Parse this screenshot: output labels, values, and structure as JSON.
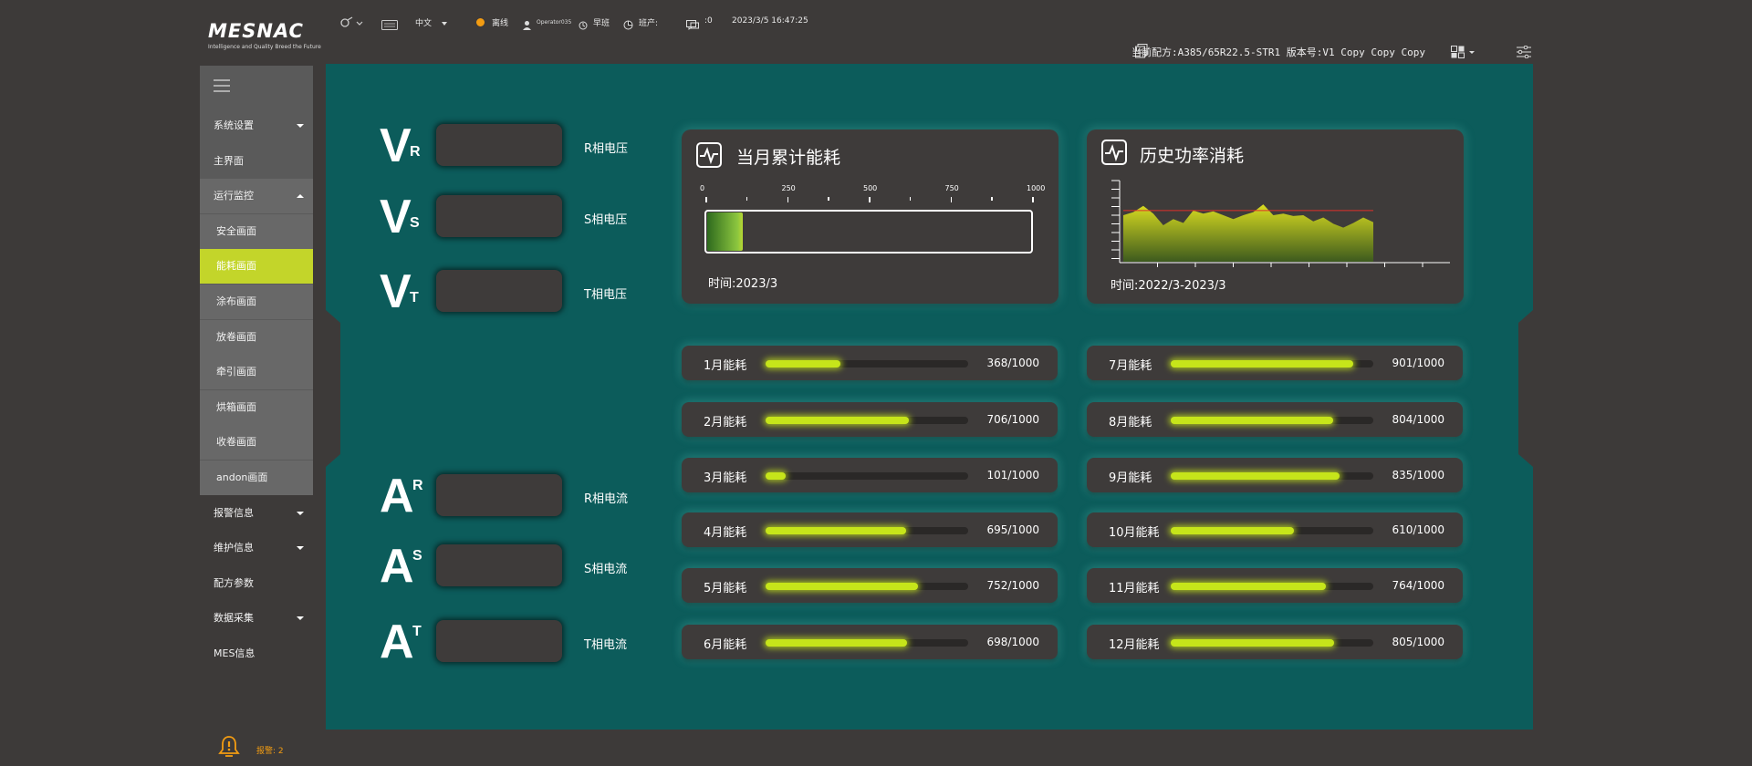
{
  "header": {
    "logo": "MESNAC",
    "tagline": "Intelligence and Quality Breed the Future",
    "language": "中文",
    "status": "离线",
    "user": "Operator035",
    "shift": "早班",
    "output_label": "班产:",
    "message_count": ":0",
    "datetime": "2023/3/5 16:47:25",
    "recipe": "当前配方:A385/65R22.5-STR1 版本号:V1 Copy Copy Copy",
    "colors": {
      "status_dot": "#f39c12"
    }
  },
  "sidebar": {
    "items": [
      {
        "label": "系统设置",
        "caret": "down"
      },
      {
        "label": "主界面"
      },
      {
        "label": "运行监控",
        "caret": "up"
      },
      {
        "label": "安全画面"
      },
      {
        "label": "能耗画面",
        "active": true
      },
      {
        "label": "涂布画面"
      },
      {
        "label": "放卷画面"
      },
      {
        "label": "牵引画面"
      },
      {
        "label": "烘箱画面"
      },
      {
        "label": "收卷画面"
      },
      {
        "label": "andon画面"
      },
      {
        "label": "报警信息",
        "caret": "down"
      },
      {
        "label": "维护信息",
        "caret": "down"
      },
      {
        "label": "配方参数"
      },
      {
        "label": "数据采集",
        "caret": "down"
      },
      {
        "label": "MES信息"
      }
    ]
  },
  "electrical": {
    "voltage": [
      {
        "letter": "V",
        "sub": "R",
        "label": "R相电压"
      },
      {
        "letter": "V",
        "sub": "S",
        "label": "S相电压"
      },
      {
        "letter": "V",
        "sub": "T",
        "label": "T相电压"
      }
    ],
    "current": [
      {
        "letter": "A",
        "sub": "R",
        "label": "R相电流"
      },
      {
        "letter": "A",
        "sub": "S",
        "label": "S相电流"
      },
      {
        "letter": "A",
        "sub": "T",
        "label": "T相电流"
      }
    ]
  },
  "monthly_card": {
    "title": "当月累计能耗",
    "ticks": [
      "0",
      "250",
      "500",
      "750",
      "1000"
    ],
    "value": 110,
    "max": 1000,
    "time": "时间:2023/3"
  },
  "history_card": {
    "title": "历史功率消耗",
    "time": "时间:2022/3-2023/3",
    "series": [
      60,
      64,
      72,
      62,
      47,
      55,
      50,
      66,
      62,
      65,
      60,
      55,
      60,
      64,
      74,
      60,
      62,
      59,
      60,
      52,
      57,
      49,
      44,
      50,
      57,
      51
    ],
    "limit": 66
  },
  "months": [
    {
      "label": "1月能耗",
      "value": 368,
      "text": "368/1000"
    },
    {
      "label": "2月能耗",
      "value": 706,
      "text": "706/1000"
    },
    {
      "label": "3月能耗",
      "value": 101,
      "text": "101/1000"
    },
    {
      "label": "4月能耗",
      "value": 695,
      "text": "695/1000"
    },
    {
      "label": "5月能耗",
      "value": 752,
      "text": "752/1000"
    },
    {
      "label": "6月能耗",
      "value": 698,
      "text": "698/1000"
    },
    {
      "label": "7月能耗",
      "value": 901,
      "text": "901/1000"
    },
    {
      "label": "8月能耗",
      "value": 804,
      "text": "804/1000"
    },
    {
      "label": "9月能耗",
      "value": 835,
      "text": "835/1000"
    },
    {
      "label": "10月能耗",
      "value": 610,
      "text": "610/1000"
    },
    {
      "label": "11月能耗",
      "value": 764,
      "text": "764/1000"
    },
    {
      "label": "12月能耗",
      "value": 805,
      "text": "805/1000"
    }
  ],
  "footer": {
    "alarm": "报警: 2"
  }
}
